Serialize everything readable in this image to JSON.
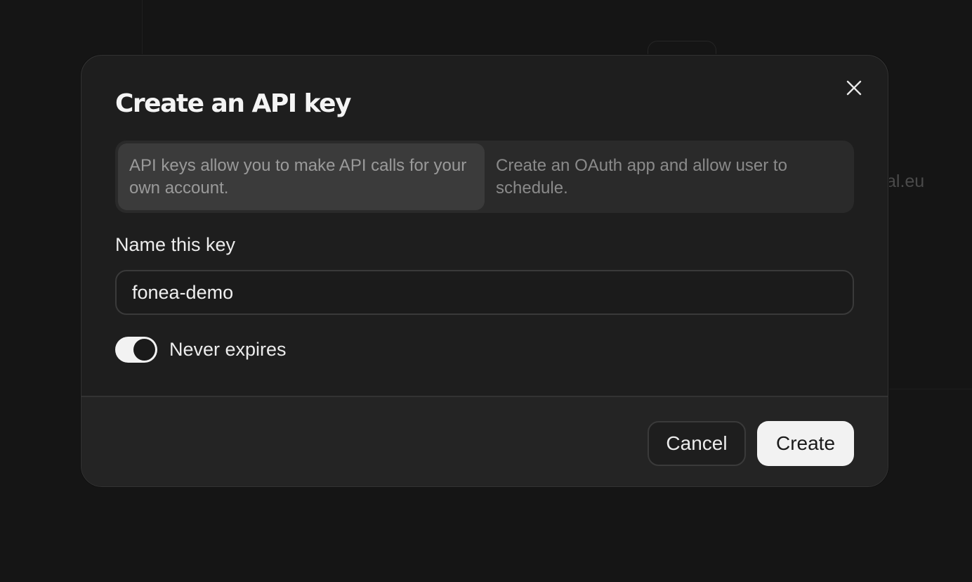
{
  "background": {
    "partial_text": "al.eu"
  },
  "modal": {
    "title": "Create an API key",
    "close_icon": "close-icon",
    "key_type_options": [
      {
        "label": "API keys allow you to make API calls for your own account.",
        "selected": true
      },
      {
        "label": "Create an OAuth app and allow user to schedule.",
        "selected": false
      }
    ],
    "name_field": {
      "label": "Name this key",
      "value": "fonea-demo"
    },
    "never_expires": {
      "label": "Never expires",
      "enabled": true
    },
    "footer": {
      "cancel_label": "Cancel",
      "create_label": "Create"
    }
  },
  "colors": {
    "page_background": "#151515",
    "modal_background": "#1e1e1e",
    "footer_background": "#242424",
    "primary_button": "#f2f2f2"
  }
}
